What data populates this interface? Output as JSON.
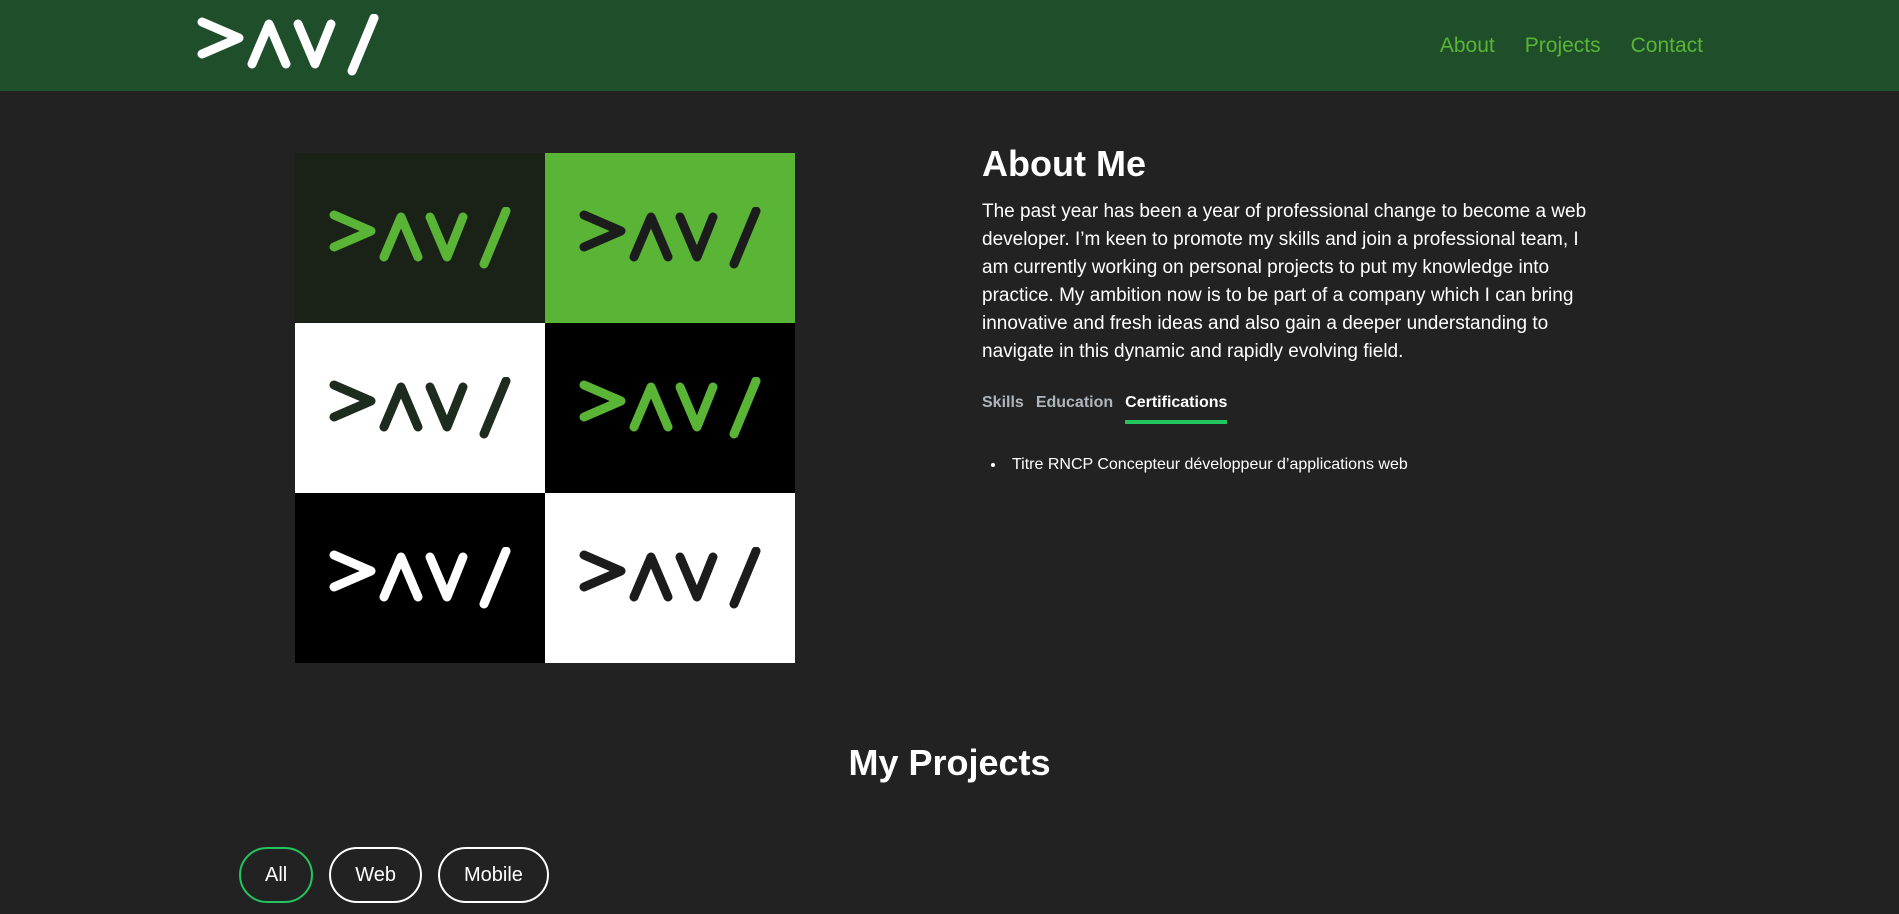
{
  "logo_text": ">AV/",
  "nav": {
    "about": "About",
    "projects": "Projects",
    "contact": "Contact"
  },
  "colors": {
    "header_bg": "#1e4e2a",
    "page_bg": "#222222",
    "accent_green": "#5ab536",
    "tab_underline": "#22c55e"
  },
  "logo_variants": [
    {
      "bg": "#1a2218",
      "fg": "#5ab536"
    },
    {
      "bg": "#5ab536",
      "fg": "#1c1c1c"
    },
    {
      "bg": "#ffffff",
      "fg": "#1e2b1f"
    },
    {
      "bg": "#000000",
      "fg": "#5ab536"
    },
    {
      "bg": "#000000",
      "fg": "#ffffff"
    },
    {
      "bg": "#ffffff",
      "fg": "#1c1c1c"
    }
  ],
  "about": {
    "title": "About Me",
    "text": "The past year has been a year of professional change to become a web developer. I’m keen to promote my skills and join a professional team, I am currently working on personal projects to put my knowledge into practice. My ambition now is to be part of a company which I can bring innovative and fresh ideas and also gain a deeper understanding to navigate in this dynamic and rapidly evolving field.",
    "tabs": {
      "skills": "Skills",
      "education": "Education",
      "certifications": "Certifications"
    },
    "active_tab": "Certifications",
    "certifications": [
      "Titre RNCP Concepteur développeur d’applications web"
    ]
  },
  "projects": {
    "title": "My Projects",
    "filters": {
      "all": "All",
      "web": "Web",
      "mobile": "Mobile"
    },
    "active_filter": "All"
  }
}
